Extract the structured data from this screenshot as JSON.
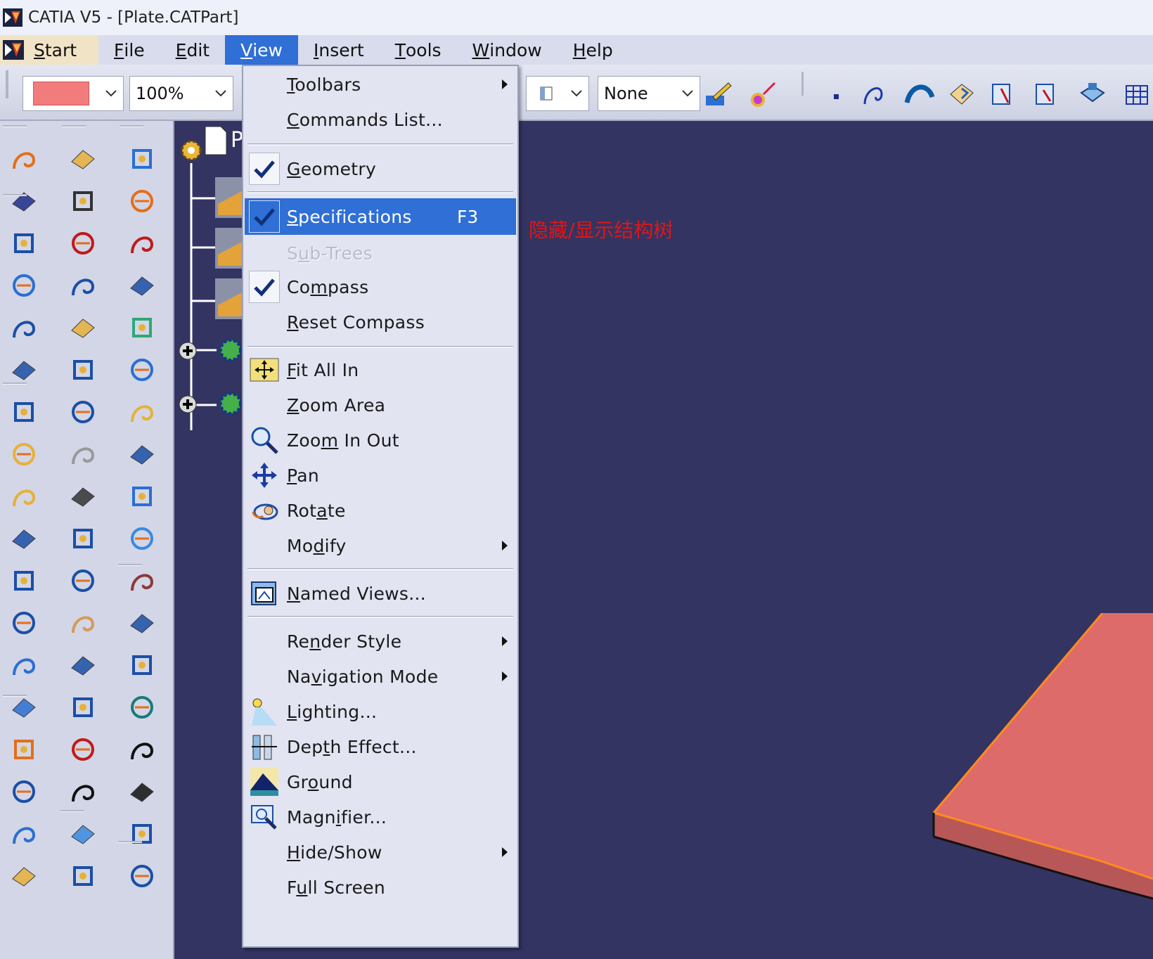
{
  "window": {
    "title": "CATIA V5 - [Plate.CATPart]"
  },
  "menubar": {
    "start": "Start",
    "items": [
      {
        "label": "File",
        "accel": "F",
        "rest": "ile"
      },
      {
        "label": "Edit",
        "accel": "E",
        "rest": "dit"
      },
      {
        "label": "View",
        "accel": "V",
        "rest": "iew"
      },
      {
        "label": "Insert",
        "accel": "I",
        "rest": "nsert"
      },
      {
        "label": "Tools",
        "accel": "T",
        "rest": "ools"
      },
      {
        "label": "Window",
        "accel": "W",
        "rest": "indow"
      },
      {
        "label": "Help",
        "accel": "H",
        "rest": "elp"
      }
    ],
    "active": "View"
  },
  "toolbar": {
    "color_swatch": "#f27c7c",
    "zoom_value": "100%",
    "style_value": "None"
  },
  "view_menu": {
    "items": [
      {
        "pre": "",
        "u": "T",
        "post": "oolbars",
        "submenu": true
      },
      {
        "pre": "",
        "u": "C",
        "post": "ommands List...",
        "submenu": false
      },
      {
        "pre": "",
        "u": "G",
        "post": "eometry",
        "checked": true
      },
      {
        "pre": "",
        "u": "S",
        "post": "pecifications",
        "checked": true,
        "shortcut": "F3",
        "highlighted": true
      },
      {
        "pre": "S",
        "u": "u",
        "post": "b-Trees",
        "disabled": true
      },
      {
        "pre": "Co",
        "u": "m",
        "post": "pass",
        "checked": true
      },
      {
        "pre": "",
        "u": "R",
        "post": "eset Compass"
      },
      {
        "pre": "",
        "u": "F",
        "post": "it All In",
        "icon": "fit-all-in-icon"
      },
      {
        "pre": "",
        "u": "Z",
        "post": "oom Area"
      },
      {
        "pre": "Zoo",
        "u": "m",
        "post": " In Out",
        "icon": "zoom-in-out-icon"
      },
      {
        "pre": "",
        "u": "P",
        "post": "an",
        "icon": "pan-icon"
      },
      {
        "pre": "Rot",
        "u": "a",
        "post": "te",
        "icon": "rotate-icon"
      },
      {
        "pre": "Mo",
        "u": "d",
        "post": "ify",
        "submenu": true
      },
      {
        "pre": "",
        "u": "N",
        "post": "amed Views...",
        "icon": "named-views-icon"
      },
      {
        "pre": "Re",
        "u": "n",
        "post": "der Style",
        "submenu": true
      },
      {
        "pre": "Na",
        "u": "v",
        "post": "igation Mode",
        "submenu": true
      },
      {
        "pre": "",
        "u": "L",
        "post": "ighting...",
        "icon": "lighting-icon"
      },
      {
        "pre": "Dep",
        "u": "t",
        "post": "h Effect...",
        "icon": "depth-effect-icon"
      },
      {
        "pre": "Gr",
        "u": "o",
        "post": "und",
        "icon": "ground-icon"
      },
      {
        "pre": "Magn",
        "u": "i",
        "post": "fier...",
        "icon": "magnifier-icon"
      },
      {
        "pre": "",
        "u": "H",
        "post": "ide/Show",
        "submenu": true
      },
      {
        "pre": "F",
        "u": "u",
        "post": "ll Screen"
      }
    ]
  },
  "tree": {
    "root_letter": "P"
  },
  "annotation": "隐藏/显示结构树",
  "colors": {
    "highlight": "#2f6fd6",
    "viewport_bg": "#333462",
    "plate_face": "#dd6b6a",
    "plate_edge": "#ff8a1f",
    "annotation": "#e01616"
  }
}
